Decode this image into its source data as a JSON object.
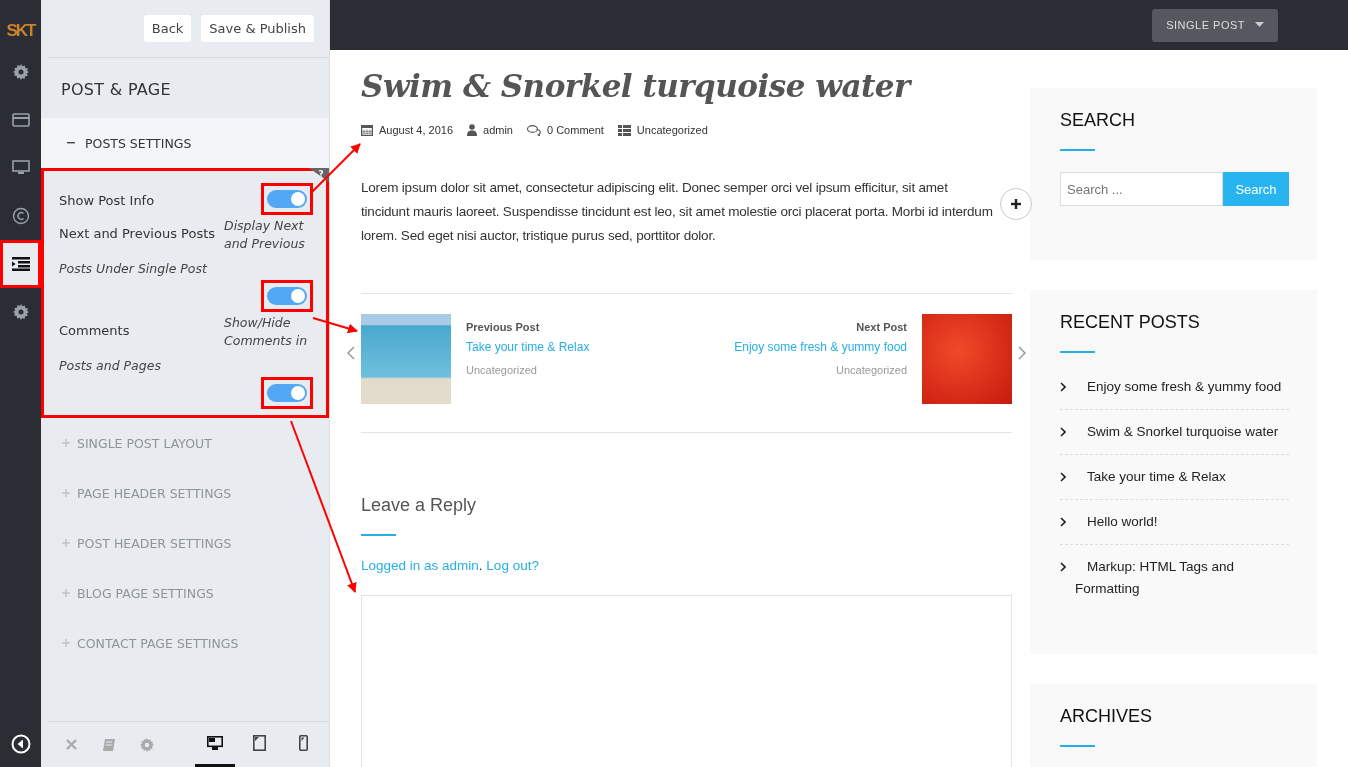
{
  "rail": {
    "logo": "SKT",
    "items": [
      {
        "kind": "gear",
        "selected": false,
        "highlighted": false
      },
      {
        "kind": "card",
        "selected": false,
        "highlighted": false
      },
      {
        "kind": "monitor",
        "selected": false,
        "highlighted": false
      },
      {
        "kind": "copyright",
        "selected": false,
        "highlighted": false
      },
      {
        "kind": "list",
        "selected": true,
        "highlighted": true
      },
      {
        "kind": "gear",
        "selected": false,
        "highlighted": false
      }
    ]
  },
  "panel": {
    "buttons": [
      "Back",
      "Save & Publish"
    ],
    "title": "POST & PAGE",
    "open_section": {
      "label": "POSTS SETTINGS",
      "expanded": true,
      "highlighted": true,
      "help": "?",
      "settings": [
        {
          "label": "Show Post Info",
          "on": true,
          "highlighted": true
        },
        {
          "label": "Next and Previous Posts",
          "description": [
            "Display Next and Previous",
            "Posts Under Single Post"
          ],
          "on": true,
          "highlighted": true
        },
        {
          "label": "Comments",
          "description": [
            "Show/Hide Comments in",
            "Posts and Pages"
          ],
          "on": true,
          "highlighted": true
        }
      ]
    },
    "sections": [
      {
        "label": "SINGLE POST LAYOUT",
        "expanded": false
      },
      {
        "label": "PAGE HEADER SETTINGS",
        "expanded": false
      },
      {
        "label": "POST HEADER SETTINGS",
        "expanded": false
      },
      {
        "label": "BLOG PAGE SETTINGS",
        "expanded": false
      },
      {
        "label": "CONTACT PAGE SETTINGS",
        "expanded": false
      }
    ],
    "footer": {
      "tools": [
        {
          "kind": "close"
        },
        {
          "kind": "book"
        },
        {
          "kind": "gear"
        }
      ],
      "devices": [
        {
          "kind": "desktop",
          "selected": true
        },
        {
          "kind": "tablet",
          "selected": false
        },
        {
          "kind": "phone",
          "selected": false
        }
      ]
    }
  },
  "topbar": {
    "view_menu": "SINGLE POST"
  },
  "post": {
    "title": "Swim & Snorkel turquoise water",
    "meta": [
      {
        "kind": "date",
        "text": "August 4, 2016"
      },
      {
        "kind": "author",
        "text": "admin"
      },
      {
        "kind": "comments",
        "text": "0 Comment"
      },
      {
        "kind": "category",
        "text": "Uncategorized"
      }
    ],
    "body": "Lorem ipsum dolor sit amet, consectetur adipiscing elit. Donec semper orci vel ipsum efficitur, sit amet tincidunt mauris laoreet. Suspendisse tincidunt est leo, sit amet molestie orci placerat porta. Morbi id interdum lorem. Sed eget nisi auctor, tristique purus sed, porttitor dolor.",
    "nav": [
      {
        "kind": "previous",
        "heading": "Previous Post",
        "title": "Take your time & Relax",
        "category": "Uncategorized"
      },
      {
        "kind": "next",
        "heading": "Next Post",
        "title": "Enjoy some fresh & yummy food",
        "category": "Uncategorized"
      }
    ],
    "reply": {
      "heading": "Leave a Reply",
      "logged_in": "Logged in as admin",
      "separator": ".",
      "logout": "Log out?"
    }
  },
  "sidebar": {
    "search": {
      "title": "SEARCH",
      "placeholder": "Search ...",
      "button": "Search"
    },
    "recent": {
      "title": "RECENT POSTS",
      "items": [
        "Enjoy some fresh & yummy food",
        "Swim & Snorkel turquoise water",
        "Take your time & Relax",
        "Hello world!",
        "Markup: HTML Tags and Formatting"
      ]
    },
    "archives": {
      "title": "ARCHIVES"
    }
  }
}
